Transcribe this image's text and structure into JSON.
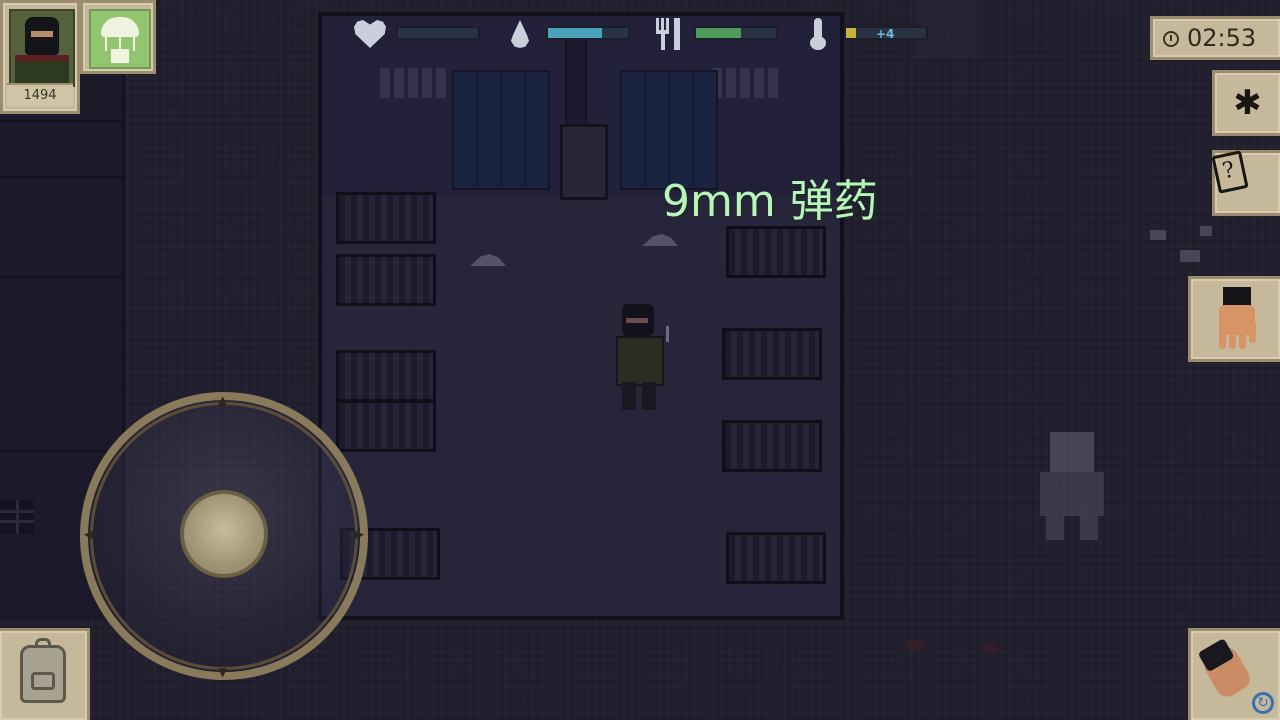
{
  "player": {
    "score": "1494"
  },
  "stats": {
    "health": {
      "icon": "heart-icon",
      "level": 0.0,
      "color": "#2a3344"
    },
    "thirst": {
      "icon": "water-drop-icon",
      "level": 0.68,
      "color": "#4aa3b8"
    },
    "hunger": {
      "icon": "fork-knife-icon",
      "level": 0.56,
      "color": "#4f9a5c"
    },
    "temperature": {
      "icon": "thermometer-icon",
      "level": 0.12,
      "color": "#c9b13a",
      "mark": "+4"
    }
  },
  "clock": {
    "time": "02:53"
  },
  "pickup": {
    "label": "9mm 弹药"
  },
  "buttons": {
    "airdrop": "parachute-icon",
    "settings": "gear-icon",
    "quests": "quest-note-icon",
    "interact": "hand-icon",
    "weapon": "fist-icon",
    "inventory": "backpack-icon"
  }
}
